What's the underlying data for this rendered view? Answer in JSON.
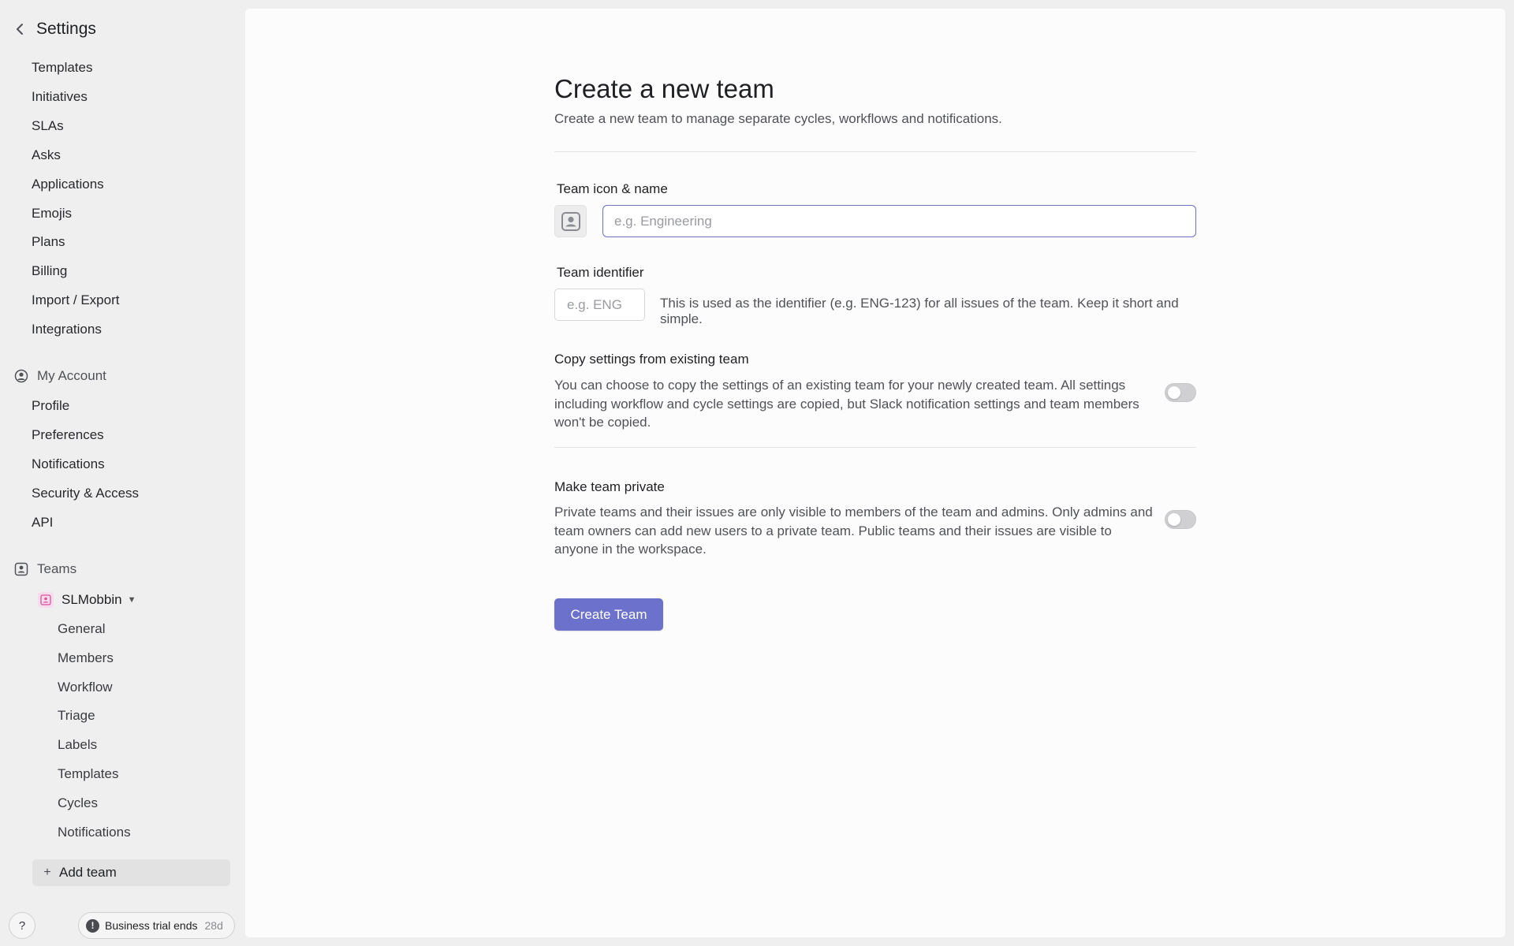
{
  "sidebar": {
    "title": "Settings",
    "workspace_items": [
      {
        "label": "Templates"
      },
      {
        "label": "Initiatives"
      },
      {
        "label": "SLAs"
      },
      {
        "label": "Asks"
      },
      {
        "label": "Applications"
      },
      {
        "label": "Emojis"
      },
      {
        "label": "Plans"
      },
      {
        "label": "Billing"
      },
      {
        "label": "Import / Export"
      },
      {
        "label": "Integrations"
      }
    ],
    "my_account": {
      "heading": "My Account",
      "items": [
        {
          "label": "Profile"
        },
        {
          "label": "Preferences"
        },
        {
          "label": "Notifications"
        },
        {
          "label": "Security & Access"
        },
        {
          "label": "API"
        }
      ]
    },
    "teams": {
      "heading": "Teams",
      "team_name": "SLMobbin",
      "team_color": "#d9539b",
      "items": [
        {
          "label": "General"
        },
        {
          "label": "Members"
        },
        {
          "label": "Workflow"
        },
        {
          "label": "Triage"
        },
        {
          "label": "Labels"
        },
        {
          "label": "Templates"
        },
        {
          "label": "Cycles"
        },
        {
          "label": "Notifications"
        }
      ],
      "add_team_label": "Add team"
    },
    "help_label": "?",
    "trial": {
      "label": "Business trial ends",
      "days": "28d"
    }
  },
  "main": {
    "title": "Create a new team",
    "subtitle": "Create a new team to manage separate cycles, workflows and notifications.",
    "name_field": {
      "label": "Team icon & name",
      "placeholder": "e.g. Engineering",
      "value": ""
    },
    "identifier_field": {
      "label": "Team identifier",
      "placeholder": "e.g. ENG",
      "value": "",
      "help": "This is used as the identifier (e.g. ENG-123) for all issues of the team. Keep it short and simple."
    },
    "copy_settings": {
      "label": "Copy settings from existing team",
      "description": "You can choose to copy the settings of an existing team for your newly created team. All settings including workflow and cycle settings are copied, but Slack notification settings and team members won't be copied.",
      "enabled": false
    },
    "private_team": {
      "label": "Make team private",
      "description": "Private teams and their issues are only visible to members of the team and admins. Only admins and team owners can add new users to a private team. Public teams and their issues are visible to anyone in the workspace.",
      "enabled": false
    },
    "submit_label": "Create Team"
  },
  "colors": {
    "accent": "#6c72cb",
    "input_focus": "#6a71c6"
  }
}
